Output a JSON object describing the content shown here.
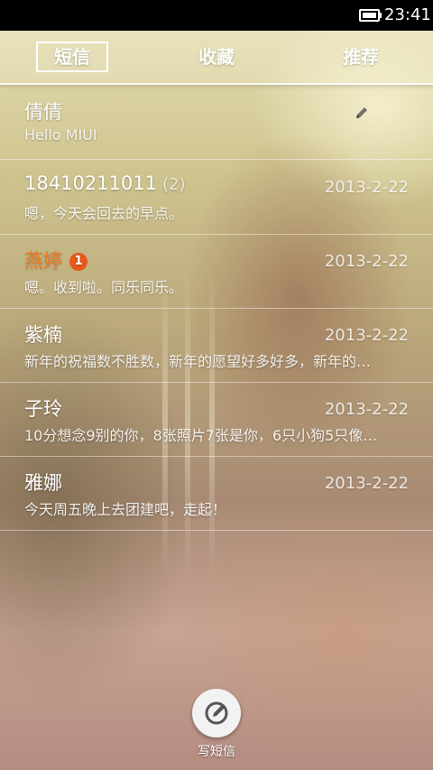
{
  "status_bar": {
    "time": "23:41",
    "battery_icon": "battery-icon"
  },
  "tabs": [
    {
      "label": "短信",
      "active": true
    },
    {
      "label": "收藏",
      "active": false
    },
    {
      "label": "推荐",
      "active": false
    }
  ],
  "conversations": [
    {
      "name": "倩倩",
      "count": "",
      "badge": "",
      "date": "",
      "draft_icon": "pencil-icon",
      "preview": "Hello MIUI"
    },
    {
      "name": "18410211011",
      "count": "(2)",
      "badge": "",
      "date": "2013-2-22",
      "preview": "嗯，今天会回去的早点。"
    },
    {
      "name": "燕婷",
      "count": "",
      "badge": "1",
      "date": "2013-2-22",
      "preview": "嗯。收到啦。同乐同乐。"
    },
    {
      "name": "紫楠",
      "count": "",
      "badge": "",
      "date": "2013-2-22",
      "preview": "新年的祝福数不胜数，新年的愿望好多好多，新年的…"
    },
    {
      "name": "子玲",
      "count": "",
      "badge": "",
      "date": "2013-2-22",
      "preview": "10分想念9别的你，8张照片7张是你，6只小狗5只像…"
    },
    {
      "name": "雅娜",
      "count": "",
      "badge": "",
      "date": "2013-2-22",
      "preview": "今天周五晚上去团建吧，走起！"
    }
  ],
  "compose": {
    "label": "写短信",
    "icon": "compose-icon"
  },
  "colors": {
    "unread_name": "#f07a1e",
    "badge": "#e8581a"
  }
}
